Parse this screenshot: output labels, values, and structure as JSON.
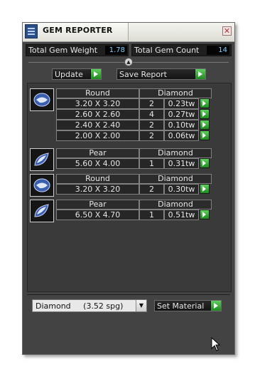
{
  "window": {
    "title": "GEM REPORTER",
    "close_glyph": "✕"
  },
  "stats": {
    "total_weight_label": "Total Gem Weight",
    "total_weight_value": "1.78",
    "total_count_label": "Total Gem Count",
    "total_count_value": "14"
  },
  "toolbar": {
    "update_label": "Update",
    "save_report_label": "Save Report"
  },
  "groups": [
    {
      "shape": "Round",
      "material": "Diamond",
      "icon": "round-gem-icon",
      "rows": [
        {
          "size": "3.20 X 3.20",
          "count": "2",
          "weight": "0.23tw"
        },
        {
          "size": "2.60 X 2.60",
          "count": "4",
          "weight": "0.27tw"
        },
        {
          "size": "2.40 X 2.40",
          "count": "2",
          "weight": "0.10tw"
        },
        {
          "size": "2.00 X 2.00",
          "count": "2",
          "weight": "0.06tw"
        }
      ]
    },
    {
      "shape": "Pear",
      "material": "Diamond",
      "icon": "pear-gem-icon",
      "rows": [
        {
          "size": "5.60 X 4.00",
          "count": "1",
          "weight": "0.31tw"
        }
      ]
    },
    {
      "shape": "Round",
      "material": "Diamond",
      "icon": "round-gem-icon",
      "rows": [
        {
          "size": "3.20 X 3.20",
          "count": "2",
          "weight": "0.30tw"
        }
      ]
    },
    {
      "shape": "Pear",
      "material": "Diamond",
      "icon": "pear-gem-icon",
      "rows": [
        {
          "size": "6.50 X 4.70",
          "count": "1",
          "weight": "0.51tw"
        }
      ]
    }
  ],
  "material_select": {
    "value": "Diamond     (3.52 spg)",
    "arrow_glyph": "▼"
  },
  "set_material_label": "Set Material",
  "colors": {
    "panel_bg": "#434343",
    "accent_green": "#3fb53f",
    "value_text": "#7fd2ff"
  }
}
